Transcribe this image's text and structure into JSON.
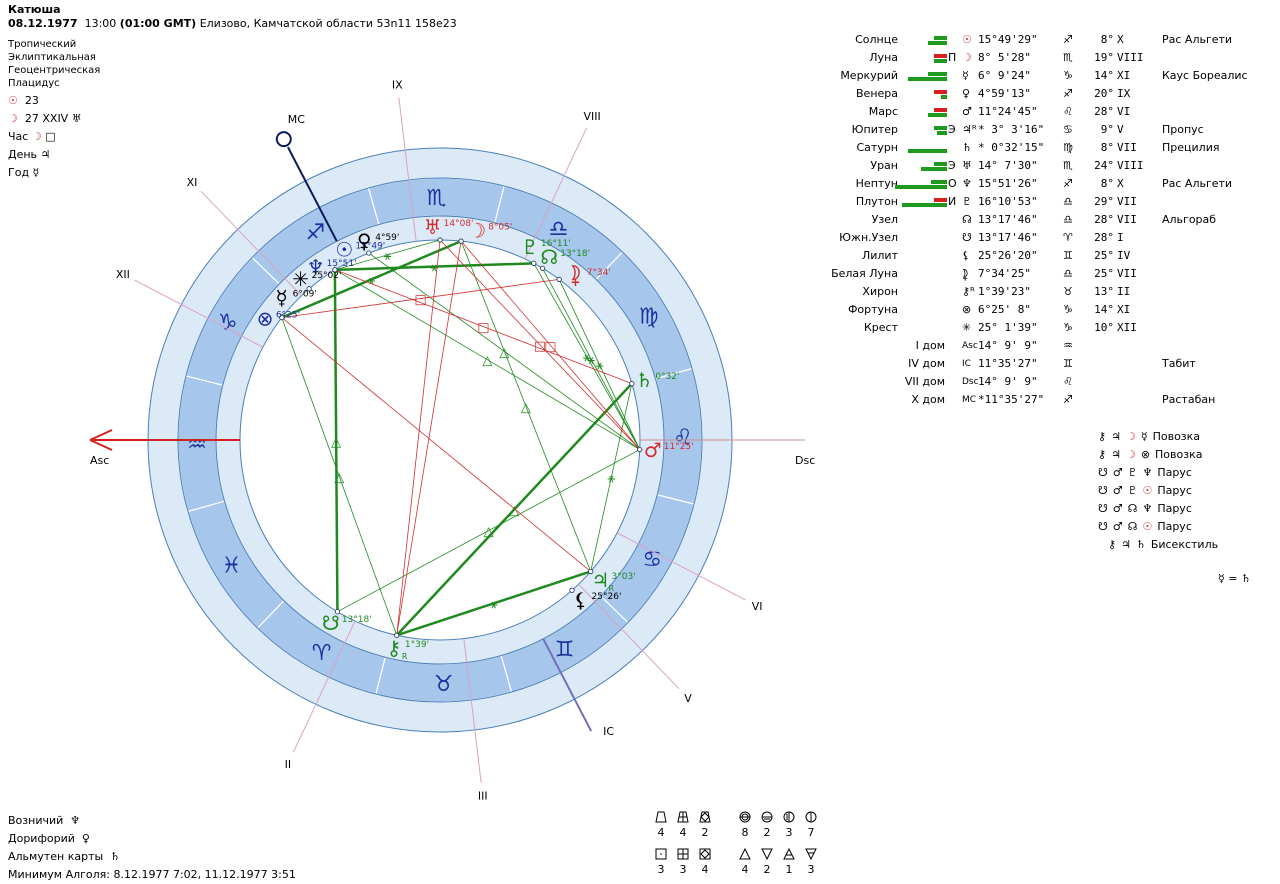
{
  "header": {
    "name": "Катюша",
    "date": "08.12.1977",
    "time": "13:00",
    "gmt": "(01:00 GMT)",
    "place": "Елизово, Камчатской области 53n11  158e23"
  },
  "settings": [
    "Тропический",
    "Эклиптикальная",
    "Геоцентрическая",
    "Плацидус"
  ],
  "lunar": {
    "sun_glyph": "☉",
    "sun_value": "23",
    "moon_glyph": "☽",
    "moon_value": "27 XXIV",
    "moon_extra_glyph": "♅"
  },
  "rulers": [
    {
      "label": "Час",
      "glyph": "☽",
      "extra": "□",
      "color": "#d03030"
    },
    {
      "label": "День",
      "glyph": "♃",
      "extra": "",
      "color": "#000000"
    },
    {
      "label": "Год",
      "glyph": "☿",
      "extra": "",
      "color": "#000000"
    }
  ],
  "colors": {
    "outer_ring": "#dce9f7",
    "zodiac_band": "#a6c6ec",
    "zodiac_glyph": "#1c2f9c",
    "house_line": "#d8a2c8",
    "asc": "#d42020",
    "mc": "#0c1a5c",
    "ic": "#7070b8",
    "green": "#1e8a1e",
    "red": "#d03030",
    "blue": "#1c2f9c"
  },
  "axes": {
    "asc": "Asc",
    "dsc": "Dsc",
    "mc": "MC",
    "ic": "IC"
  },
  "houses": [
    "I",
    "II",
    "III",
    "IV",
    "V",
    "VI",
    "VII",
    "VIII",
    "IX",
    "X",
    "XI",
    "XII"
  ],
  "zodiac": {
    "ascendant_longitude": 314.15,
    "signs": [
      "♈",
      "♉",
      "♊",
      "♋",
      "♌",
      "♍",
      "♎",
      "♏",
      "♐",
      "♑",
      "♒",
      "♓"
    ]
  },
  "planets": [
    {
      "name": "Солнце",
      "glyph": "☉",
      "letter": "",
      "position": "15°49'29\"",
      "sign": "♐",
      "degree": "8°",
      "house": "X",
      "star": "Рас Альгети",
      "lon": 255.82,
      "chart_label": "15°49'",
      "color": "#1c2f9c",
      "table_color": "#d03030",
      "retro": false,
      "bars": {
        "top": [
          [
            "green",
            2
          ]
        ],
        "bottom": [
          [
            "green",
            3
          ]
        ]
      }
    },
    {
      "name": "Луна",
      "glyph": "☽",
      "letter": "П",
      "position": "8° 5'28\"",
      "sign": "♏",
      "degree": "19°",
      "house": "VIII",
      "star": "",
      "lon": 218.09,
      "chart_label": "8°05'",
      "color": "#d03030",
      "table_color": "#d03030",
      "retro": false,
      "bars": {
        "top": [
          [
            "red",
            2
          ]
        ],
        "bottom": [
          [
            "green",
            2
          ]
        ]
      }
    },
    {
      "name": "Меркурий",
      "glyph": "☿",
      "letter": "",
      "position": "6° 9'24\"",
      "sign": "♑",
      "degree": "14°",
      "house": "XI",
      "star": "Каус Бореалис",
      "lon": 276.16,
      "chart_label": "6°09'",
      "color": "#000000",
      "table_color": "#000000",
      "retro": false,
      "bars": {
        "top": [
          [
            "green",
            3
          ]
        ],
        "bottom": [
          [
            "green",
            6
          ]
        ]
      }
    },
    {
      "name": "Венера",
      "glyph": "♀",
      "letter": "",
      "position": "4°59'13\"",
      "sign": "♐",
      "degree": "20°",
      "house": "IX",
      "star": "",
      "lon": 244.99,
      "chart_label": "4°59'",
      "color": "#000000",
      "table_color": "#000000",
      "retro": false,
      "bars": {
        "top": [
          [
            "red",
            2
          ]
        ],
        "bottom": [
          [
            "green",
            1
          ]
        ]
      }
    },
    {
      "name": "Марс",
      "glyph": "♂",
      "letter": "",
      "position": "11°24'45\"",
      "sign": "♌",
      "degree": "28°",
      "house": "VI",
      "star": "",
      "lon": 131.41,
      "chart_label": "11°25'",
      "color": "#d03030",
      "table_color": "#000000",
      "retro": false,
      "bars": {
        "top": [
          [
            "red",
            2
          ]
        ],
        "bottom": [
          [
            "green",
            3
          ]
        ]
      }
    },
    {
      "name": "Юпитер",
      "glyph": "♃",
      "letter": "Э",
      "position": "* 3° 3'16\"",
      "sign": "♋",
      "degree": "9°",
      "house": "V",
      "star": "Пропус",
      "lon": 93.05,
      "chart_label": "3°03'",
      "color": "#1e8a1e",
      "table_color": "#000000",
      "retro": true,
      "bars": {
        "top": [
          [
            "green",
            2
          ]
        ],
        "bottom": [
          [
            "green",
            1.5
          ]
        ]
      }
    },
    {
      "name": "Сатурн",
      "glyph": "♄",
      "letter": "",
      "position": "* 0°32'15\"",
      "sign": "♍",
      "degree": "8°",
      "house": "VII",
      "star": "Прецилия",
      "lon": 150.54,
      "chart_label": "0°32'",
      "color": "#1e8a1e",
      "table_color": "#000000",
      "retro": false,
      "bars": {
        "top": [],
        "bottom": [
          [
            "green",
            6
          ]
        ]
      }
    },
    {
      "name": "Уран",
      "glyph": "♅",
      "letter": "Э",
      "position": "14° 7'30\"",
      "sign": "♏",
      "degree": "24°",
      "house": "VIII",
      "star": "",
      "lon": 224.13,
      "chart_label": "14°08'",
      "color": "#d03030",
      "table_color": "#000000",
      "retro": false,
      "bars": {
        "top": [
          [
            "green",
            2
          ]
        ],
        "bottom": [
          [
            "green",
            4
          ]
        ]
      }
    },
    {
      "name": "Нептун",
      "glyph": "♆",
      "letter": "О",
      "position": "15°51'26\"",
      "sign": "♐",
      "degree": "8°",
      "house": "X",
      "star": "Рас Альгети",
      "lon": 255.86,
      "chart_label": "15°51'",
      "color": "#1c2f9c",
      "table_color": "#000000",
      "retro": false,
      "bars": {
        "top": [
          [
            "green",
            2.5
          ]
        ],
        "bottom": [
          [
            "green",
            8
          ]
        ]
      }
    },
    {
      "name": "Плутон",
      "glyph": "♇",
      "letter": "И",
      "position": "16°10'53\"",
      "sign": "♎",
      "degree": "29°",
      "house": "VII",
      "star": "",
      "lon": 196.18,
      "chart_label": "16°11'",
      "color": "#1e8a1e",
      "table_color": "#000000",
      "retro": false,
      "bars": {
        "top": [
          [
            "red",
            2
          ]
        ],
        "bottom": [
          [
            "green",
            7
          ]
        ]
      }
    },
    {
      "name": "Узел",
      "glyph": "☊",
      "letter": "",
      "position": "13°17'46\"",
      "sign": "♎",
      "degree": "28°",
      "house": "VII",
      "star": "Альгораб",
      "lon": 193.3,
      "chart_label": "13°18'",
      "color": "#1e8a1e",
      "table_color": "#000000",
      "retro": false,
      "bars": null
    },
    {
      "name": "Южн.Узел",
      "glyph": "☋",
      "letter": "",
      "position": "13°17'46\"",
      "sign": "♈",
      "degree": "28°",
      "house": "I",
      "star": "",
      "lon": 13.3,
      "chart_label": "13°18'",
      "color": "#1e8a1e",
      "table_color": "#000000",
      "retro": false,
      "bars": null
    },
    {
      "name": "Лилит",
      "glyph": "⚸",
      "letter": "",
      "position": "25°26'20\"",
      "sign": "♊",
      "degree": "25°",
      "house": "IV",
      "star": "",
      "lon": 85.44,
      "chart_label": "25°26'",
      "color": "#000000",
      "table_color": "#000000",
      "retro": false,
      "bars": null
    },
    {
      "name": "Белая Луна",
      "glyph": "⯝",
      "letter": "",
      "position": "7°34'25\"",
      "sign": "♎",
      "degree": "25°",
      "house": "VII",
      "star": "",
      "lon": 187.57,
      "chart_label": "7°34'",
      "color": "#d03030",
      "table_color": "#000000",
      "retro": false,
      "bars": null
    },
    {
      "name": "Хирон",
      "glyph": "⚷",
      "letter": "",
      "position": "1°39'23\"",
      "sign": "♉",
      "degree": "13°",
      "house": "II",
      "star": "",
      "lon": 31.66,
      "chart_label": "1°39'",
      "color": "#1e8a1e",
      "table_color": "#000000",
      "retro": true,
      "bars": null
    },
    {
      "name": "Фортуна",
      "glyph": "⊗",
      "letter": "",
      "position": "6°25' 8\"",
      "sign": "♑",
      "degree": "14°",
      "house": "XI",
      "star": "",
      "lon": 276.42,
      "chart_label": "6°25'",
      "color": "#1c2f9c",
      "table_color": "#000000",
      "retro": false,
      "bars": null
    },
    {
      "name": "Крест",
      "glyph": "✳",
      "letter": "",
      "position": "25° 1'39\"",
      "sign": "♑",
      "degree": "10°",
      "house": "XII",
      "star": "",
      "lon": 265.03,
      "chart_label": "25°02'",
      "color": "#000000",
      "table_color": "#000000",
      "retro": false,
      "bars": null
    }
  ],
  "house_cusps": [
    {
      "label": "I дом",
      "glyph": "Asc",
      "position": "14° 9' 9\"",
      "sign": "♒",
      "star": ""
    },
    {
      "label": "IV дом",
      "glyph": "IC",
      "position": "11°35'27\"",
      "sign": "♊",
      "star": "Табит"
    },
    {
      "label": "VII дом",
      "glyph": "Dsc",
      "position": "14° 9' 9\"",
      "sign": "♌",
      "star": ""
    },
    {
      "label": "X дом",
      "glyph": "MC",
      "position": "*11°35'27\"",
      "sign": "♐",
      "star": "Растабан"
    }
  ],
  "configurations": [
    {
      "glyphs": [
        "⚷",
        "♃",
        "☽",
        "☿"
      ],
      "name": "Повозка"
    },
    {
      "glyphs": [
        "⚷",
        "♃",
        "☽",
        "⊗"
      ],
      "name": "Повозка"
    },
    {
      "glyphs": [
        "☋",
        "♂",
        "♇",
        "♆"
      ],
      "name": "Парус"
    },
    {
      "glyphs": [
        "☋",
        "♂",
        "♇",
        "☉"
      ],
      "name": "Парус"
    },
    {
      "glyphs": [
        "☋",
        "♂",
        "☊",
        "♆"
      ],
      "name": "Парус"
    },
    {
      "glyphs": [
        "☋",
        "♂",
        "☊",
        "☉"
      ],
      "name": "Парус"
    },
    {
      "glyphs": [
        "⚷",
        "♃",
        "♄"
      ],
      "name": "Бисекстиль"
    }
  ],
  "equation": "☿ = ♄",
  "aspects": [
    {
      "a": "Нептун",
      "b": "Плутон",
      "type": "sextile",
      "strong": true
    },
    {
      "a": "Нептун",
      "b": "Южн.Узел",
      "type": "trine",
      "strong": true
    },
    {
      "a": "Фортуна",
      "b": "Луна",
      "type": "sextile",
      "strong": true
    },
    {
      "a": "Хирон",
      "b": "Сатурн",
      "type": "trine",
      "strong": true
    },
    {
      "a": "Хирон",
      "b": "Юпитер",
      "type": "sextile",
      "strong": true
    },
    {
      "a": "Венера",
      "b": "Марс",
      "type": "trine",
      "strong": false
    },
    {
      "a": "Фортуна",
      "b": "Хирон",
      "type": "trine",
      "strong": false
    },
    {
      "a": "Южн.Узел",
      "b": "Марс",
      "type": "trine",
      "strong": false
    },
    {
      "a": "Солнце",
      "b": "Марс",
      "type": "trine",
      "strong": false
    },
    {
      "a": "Плутон",
      "b": "Марс",
      "type": "sextile",
      "strong": false
    },
    {
      "a": "Узел",
      "b": "Марс",
      "type": "sextile",
      "strong": false
    },
    {
      "a": "Белая Луна",
      "b": "Марс",
      "type": "sextile",
      "strong": false
    },
    {
      "a": "Луна",
      "b": "Юпитер",
      "type": "trine",
      "strong": false
    },
    {
      "a": "Юпитер",
      "b": "Сатурн",
      "type": "sextile",
      "strong": false
    },
    {
      "a": "Нептун",
      "b": "Уран",
      "type": "sextile",
      "strong": false
    },
    {
      "a": "Луна",
      "b": "Хирон",
      "type": "opposition",
      "strong": false
    },
    {
      "a": "Уран",
      "b": "Хирон",
      "type": "opposition",
      "strong": false
    },
    {
      "a": "Луна",
      "b": "Марс",
      "type": "square",
      "strong": false
    },
    {
      "a": "Уран",
      "b": "Марс",
      "type": "square",
      "strong": false
    },
    {
      "a": "Фортуна",
      "b": "Белая Луна",
      "type": "square",
      "strong": false
    },
    {
      "a": "Фортуна",
      "b": "Юпитер",
      "type": "opposition",
      "strong": false
    },
    {
      "a": "Солнце",
      "b": "Сатурн",
      "type": "square",
      "strong": false
    }
  ],
  "footer": {
    "lines": [
      {
        "label": "Возничий",
        "glyph": "♆"
      },
      {
        "label": "Дорифорий",
        "glyph": "♀"
      },
      {
        "label": "Альмутен карты",
        "glyph": "♄"
      }
    ],
    "algol": "Минимум Алголя: 8.12.1977  7:02,  11.12.1977  3:51"
  },
  "stats": {
    "crosses_top": [
      {
        "icon": "trapezoid-icon",
        "value": "4"
      },
      {
        "icon": "trapezoid-grid-icon",
        "value": "4"
      },
      {
        "icon": "trapezoid-diamond-icon",
        "value": "2"
      }
    ],
    "crosses_bottom": [
      {
        "icon": "square-dot-icon",
        "value": "3"
      },
      {
        "icon": "square-grid-icon",
        "value": "3"
      },
      {
        "icon": "square-diamond-icon",
        "value": "4"
      }
    ],
    "hemis": [
      {
        "icon": "circle-upper-icon",
        "value": "8"
      },
      {
        "icon": "circle-lower-icon",
        "value": "2"
      },
      {
        "icon": "circle-left-icon",
        "value": "3"
      },
      {
        "icon": "circle-right-icon",
        "value": "7"
      }
    ],
    "elements": [
      {
        "icon": "triangle-up-icon",
        "value": "4"
      },
      {
        "icon": "triangle-down-icon",
        "value": "2"
      },
      {
        "icon": "triangle-up-bar-icon",
        "value": "1"
      },
      {
        "icon": "triangle-down-bar-icon",
        "value": "3"
      }
    ]
  }
}
